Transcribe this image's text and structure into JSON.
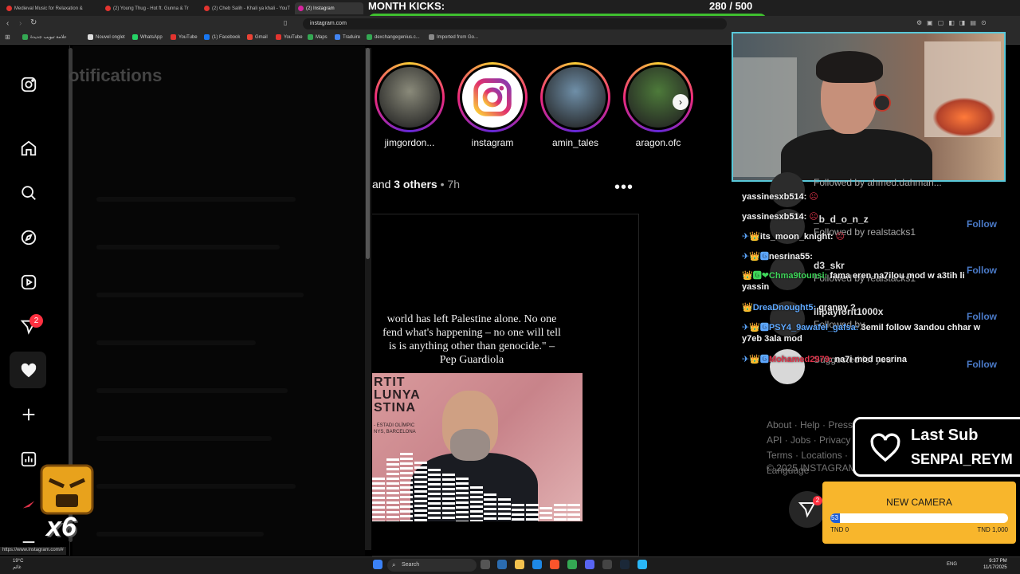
{
  "browser": {
    "tabs": [
      {
        "title": "Medieval Music for Relaxation &",
        "color": "#e3342f"
      },
      {
        "title": "(2) Young Thug - Hot ft. Gunna & Tr",
        "color": "#e3342f"
      },
      {
        "title": "(2) Cheb Salih - Khali ya khali - YouT",
        "color": "#e3342f"
      },
      {
        "title": "(2) Instagram",
        "color": "#d6249f",
        "active": true
      }
    ],
    "url": "instagram.com",
    "bookmarks": [
      "علامة تبويب جديدة",
      "Nouvel onglet",
      "WhatsApp",
      "YouTube",
      "(1) Facebook",
      "Gmail",
      "YouTube",
      "Maps",
      "Traduire",
      "dexchangegenius.c...",
      "Imported from Go..."
    ],
    "status_url": "https://www.instagram.com/#"
  },
  "kicks": {
    "title": "MONTH KICKS:",
    "count": "280",
    "separator": "/",
    "goal": "500",
    "progress": 0.56
  },
  "sidebar": {
    "badge": "2"
  },
  "notifications": {
    "title": "otifications"
  },
  "stories": [
    {
      "name": "jimgordon...",
      "color": "#8a8a7a"
    },
    {
      "name": "instagram",
      "color": "instagram"
    },
    {
      "name": "amin_tales",
      "color": "#6f8fa8"
    },
    {
      "name": "aragon.ofc",
      "color": "#4d7a3a"
    }
  ],
  "post": {
    "header_prefix": "and",
    "header_others": "3 others",
    "header_sep": "•",
    "header_time": "7h",
    "more": "•••",
    "quote": "world has left Palestine alone. No one\nfend what's happening – no one will tell\nis is anything other than genocide.\" –\nPep Guardiola",
    "photo_text": "RTIT\nLUNYA\nSTINA",
    "photo_small": "- ESTADI OLÍMPIC\nNYS, BARCELONA",
    "eq_levels": [
      0.5,
      0.72,
      0.78,
      0.68,
      0.6,
      0.55,
      0.5,
      0.4,
      0.32,
      0.26,
      0.2,
      0.2,
      0.16,
      0.2,
      0.2
    ]
  },
  "chat": [
    {
      "parts": [
        {
          "t": "yassinesxb514:",
          "c": "u"
        },
        {
          "t": " ☹",
          "c": "r"
        }
      ]
    },
    {
      "parts": [
        {
          "t": "yassinesxb514:",
          "c": "u"
        },
        {
          "t": " ☹",
          "c": "r"
        }
      ]
    },
    {
      "parts": [
        {
          "t": "✈👑",
          "c": "b"
        },
        {
          "t": "its_moon_knight:",
          "c": "u"
        },
        {
          "t": " ☹",
          "c": "r"
        }
      ]
    },
    {
      "parts": [
        {
          "t": "✈👑🅶",
          "c": "b"
        },
        {
          "t": "nesrina55:",
          "c": "u"
        }
      ]
    },
    {
      "parts": [
        {
          "t": "👑🅶❤",
          "c": "g"
        },
        {
          "t": "Chma9tounsi:",
          "c": "g"
        },
        {
          "t": " fama eren na7ilou mod w a3tih li yassin",
          "c": "u"
        }
      ]
    },
    {
      "parts": [
        {
          "t": "👑",
          "c": "g"
        },
        {
          "t": "DreaDnought5:",
          "c": "b"
        },
        {
          "t": " granny ?",
          "c": "u"
        }
      ]
    },
    {
      "parts": [
        {
          "t": "✈👑🅶",
          "c": "b"
        },
        {
          "t": "PSY4_9awafel_gafsa:",
          "c": "b"
        },
        {
          "t": " 3emil follow 3andou chhar w y7eb 3ala mod",
          "c": "u"
        }
      ]
    },
    {
      "parts": [
        {
          "t": "✈👑🅶",
          "c": "b"
        },
        {
          "t": "Mohamed2979:",
          "c": "r"
        },
        {
          "t": " na7i mod nesrina",
          "c": "u"
        }
      ]
    }
  ],
  "suggestions": [
    {
      "name": "",
      "sub": "Followed by ahmed.dahman..."
    },
    {
      "name": "_b_d_o_n_z",
      "sub": "Followed by realstacks1"
    },
    {
      "name": "d3_skr",
      "sub": "Followed by realstacks1"
    },
    {
      "name": "llipayforit1000x",
      "sub": "Followed by"
    },
    {
      "name": "",
      "sub": "Suggested for you"
    }
  ],
  "follow_label": "Follow",
  "footer": {
    "links": "About · Help · Press · API · Jobs · Privacy · Terms · Locations · Language",
    "copyright": "© 2025 INSTAGRAM"
  },
  "last_sub": {
    "label": "Last Sub",
    "name": "SENPAI_REYM"
  },
  "camera_goal": {
    "title": "NEW CAMERA",
    "current": "53",
    "progress": 0.053,
    "low": "TND 0",
    "high": "TND 1,000"
  },
  "fab_badge": "2",
  "emote": {
    "multiplier": "x6"
  },
  "taskbar": {
    "weather_temp": "19°C",
    "weather_desc": "غائم",
    "search": "Search",
    "lang": "ENG",
    "time": "9:37 PM",
    "date": "11/17/2025"
  }
}
